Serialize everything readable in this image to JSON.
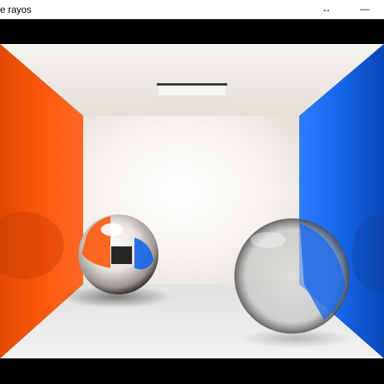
{
  "window": {
    "title": "e rayos",
    "resize_glyph": "↔",
    "minimize_glyph": "—",
    "icons": [
      "resize-icon",
      "minimize-icon"
    ]
  },
  "scene": {
    "colors": {
      "left_wall": "#ff5a10",
      "right_wall": "#1565e8",
      "back_wall": "#f4f0ea",
      "floor": "#e8e8e8",
      "ceiling": "#f2efe8",
      "light": "#ffffff",
      "frame": "#000000"
    }
  }
}
